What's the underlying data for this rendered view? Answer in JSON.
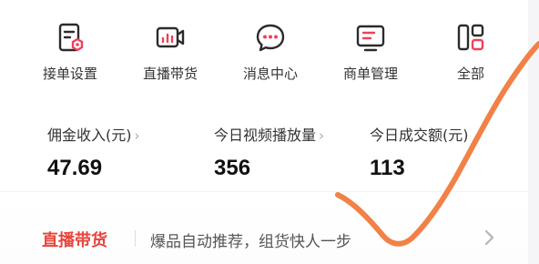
{
  "quick_actions": [
    {
      "label": "接单设置",
      "icon": "order-settings-icon"
    },
    {
      "label": "直播带货",
      "icon": "live-camera-icon"
    },
    {
      "label": "消息中心",
      "icon": "chat-bubble-icon"
    },
    {
      "label": "商单管理",
      "icon": "monitor-doc-icon"
    },
    {
      "label": "全部",
      "icon": "grid-layout-icon"
    }
  ],
  "stats": [
    {
      "label": "佣金收入(元)",
      "value": "47.69",
      "chevron": "›"
    },
    {
      "label": "今日视频播放量",
      "value": "356",
      "chevron": "›"
    },
    {
      "label": "今日成交额(元)",
      "value": "113",
      "chevron": ""
    }
  ],
  "promo": {
    "title": "直播带货",
    "text": "爆品自动推荐，组货快人一步",
    "chevron": "chevron-right-icon"
  },
  "colors": {
    "accent": "#f0405a",
    "promo_title": "#e8453c",
    "annotation_stroke": "#f07a3c",
    "icon_dark": "#2b2b2b"
  }
}
